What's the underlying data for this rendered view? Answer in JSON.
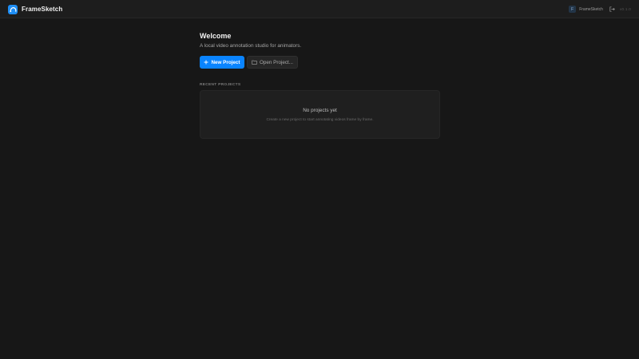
{
  "app": {
    "name": "FrameSketch",
    "logo_icon": "cloud-sketch-icon",
    "accent": "#0a84ff"
  },
  "header": {
    "user_initial": "F",
    "user_name": "FrameSketch",
    "logout_icon": "logout-icon",
    "version": "v0.1.0"
  },
  "welcome": {
    "title": "Welcome",
    "subtitle": "A local video annotation studio for animators."
  },
  "actions": {
    "new_project_label": "New Project",
    "new_project_icon": "plus-icon",
    "open_project_label": "Open Project...",
    "open_project_icon": "folder-open-icon"
  },
  "recent": {
    "section_label": "RECENT PROJECTS",
    "empty_title": "No projects yet",
    "empty_subtitle": "Create a new project to start annotating videos frame by frame."
  }
}
